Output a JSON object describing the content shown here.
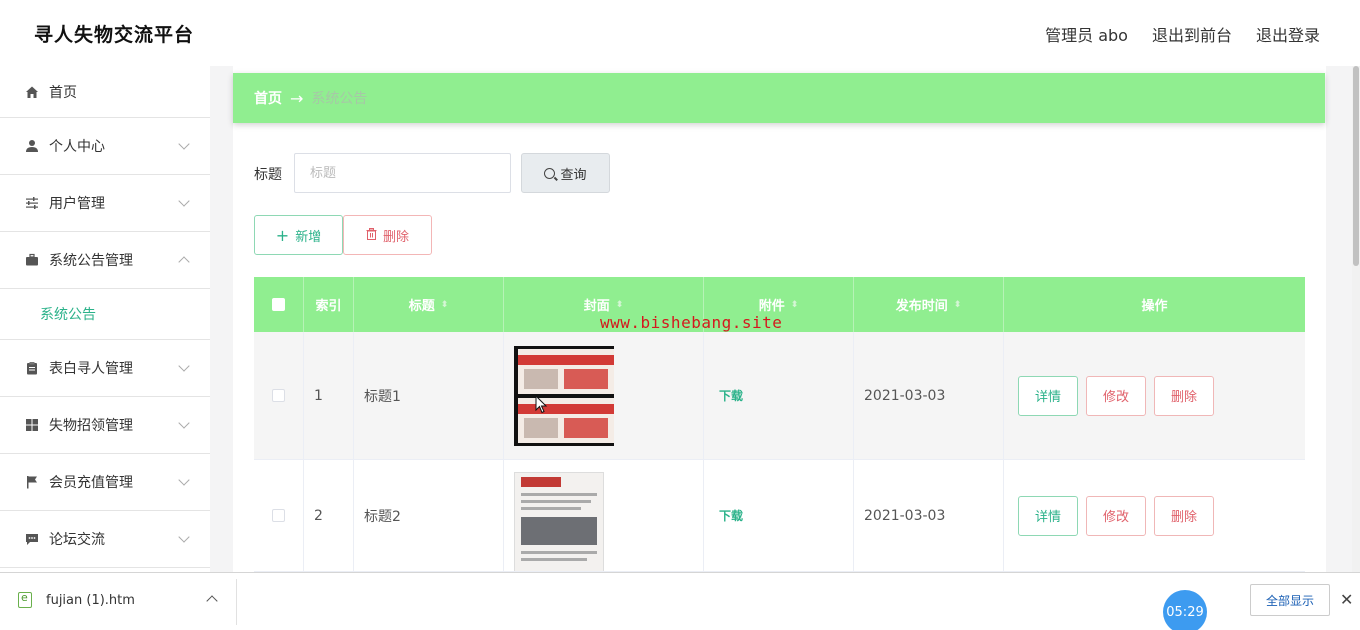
{
  "header": {
    "app_title": "寻人失物交流平台",
    "user_label": "管理员 abo",
    "front_link": "退出到前台",
    "logout_link": "退出登录"
  },
  "sidebar": {
    "items": [
      {
        "label": "首页",
        "icon": "home-icon"
      },
      {
        "label": "个人中心",
        "icon": "person-icon"
      },
      {
        "label": "用户管理",
        "icon": "sliders-icon"
      },
      {
        "label": "系统公告管理",
        "icon": "briefcase-icon"
      },
      {
        "label": "表白寻人管理",
        "icon": "clipboard-icon"
      },
      {
        "label": "失物招领管理",
        "icon": "grid-icon"
      },
      {
        "label": "会员充值管理",
        "icon": "flag-icon"
      },
      {
        "label": "论坛交流",
        "icon": "chat-icon"
      }
    ],
    "active_sub": "系统公告"
  },
  "breadcrumb": {
    "home": "首页",
    "separator": "→",
    "current": "系统公告"
  },
  "search": {
    "label": "标题",
    "placeholder": "标题",
    "value": "",
    "query_button": "查询"
  },
  "actions": {
    "add": "新增",
    "delete": "删除"
  },
  "table": {
    "columns": [
      "索引",
      "标题",
      "封面",
      "附件",
      "发布时间",
      "操作"
    ],
    "rows": [
      {
        "index": "1",
        "title": "标题1",
        "attachment": "下载",
        "date": "2021-03-03"
      },
      {
        "index": "2",
        "title": "标题2",
        "attachment": "下载",
        "date": "2021-03-03"
      }
    ],
    "ops": {
      "detail": "详情",
      "edit": "修改",
      "delete": "删除"
    }
  },
  "watermark": "www.bishebang.site",
  "download_bar": {
    "file_name": "fujian (1).htm",
    "show_all": "全部显示",
    "close": "✕"
  },
  "timer": "05:29",
  "colors": {
    "accent_green": "#90ee90",
    "link_green": "#2bb28a",
    "danger_red": "#e0606a"
  }
}
